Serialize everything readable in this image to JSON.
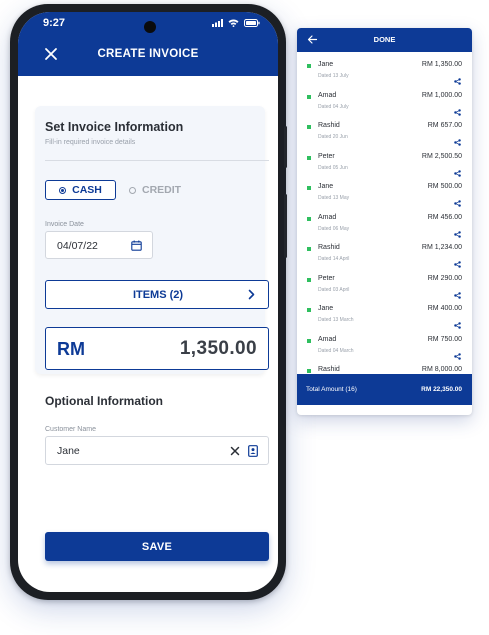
{
  "status_bar": {
    "time": "9:27"
  },
  "header": {
    "title": "CREATE INVOICE",
    "close_icon": "close-icon"
  },
  "invoice_info": {
    "title": "Set Invoice Information",
    "subtitle": "Fill-in required invoice details",
    "payment_options": [
      {
        "label": "CASH",
        "selected": true
      },
      {
        "label": "CREDIT",
        "selected": false
      }
    ],
    "date_label": "Invoice Date",
    "date_value": "04/07/22",
    "items_button": "ITEMS (2)",
    "amount_currency": "RM",
    "amount_value": "1,350.00"
  },
  "optional_info": {
    "title": "Optional Information",
    "customer_label": "Customer Name",
    "customer_value": "Jane"
  },
  "save_button": "SAVE",
  "done_panel": {
    "title": "DONE",
    "entries": [
      {
        "name": "Jane",
        "date": "Dated 13 July",
        "amount": "RM 1,350.00"
      },
      {
        "name": "Amad",
        "date": "Dated 04 July",
        "amount": "RM 1,000.00"
      },
      {
        "name": "Rashid",
        "date": "Dated 20 Jun",
        "amount": "RM 657.00"
      },
      {
        "name": "Peter",
        "date": "Dated 05 Jun",
        "amount": "RM 2,500.50"
      },
      {
        "name": "Jane",
        "date": "Dated 13 May",
        "amount": "RM 500.00"
      },
      {
        "name": "Amad",
        "date": "Dated 06 May",
        "amount": "RM 456.00"
      },
      {
        "name": "Rashid",
        "date": "Dated 14 April",
        "amount": "RM 1,234.00"
      },
      {
        "name": "Peter",
        "date": "Dated 03 April",
        "amount": "RM 290.00"
      },
      {
        "name": "Jane",
        "date": "Dated 13 March",
        "amount": "RM 400.00"
      },
      {
        "name": "Amad",
        "date": "Dated 04 March",
        "amount": "RM 750.00"
      },
      {
        "name": "Rashid",
        "date": "",
        "amount": "RM 8,000.00"
      }
    ],
    "total_label": "Total Amount (16)",
    "total_value": "RM 22,350.00"
  },
  "colors": {
    "primary": "#0d3a96",
    "accent_green": "#2fbf5f",
    "card_bg": "#f3f6fb"
  }
}
